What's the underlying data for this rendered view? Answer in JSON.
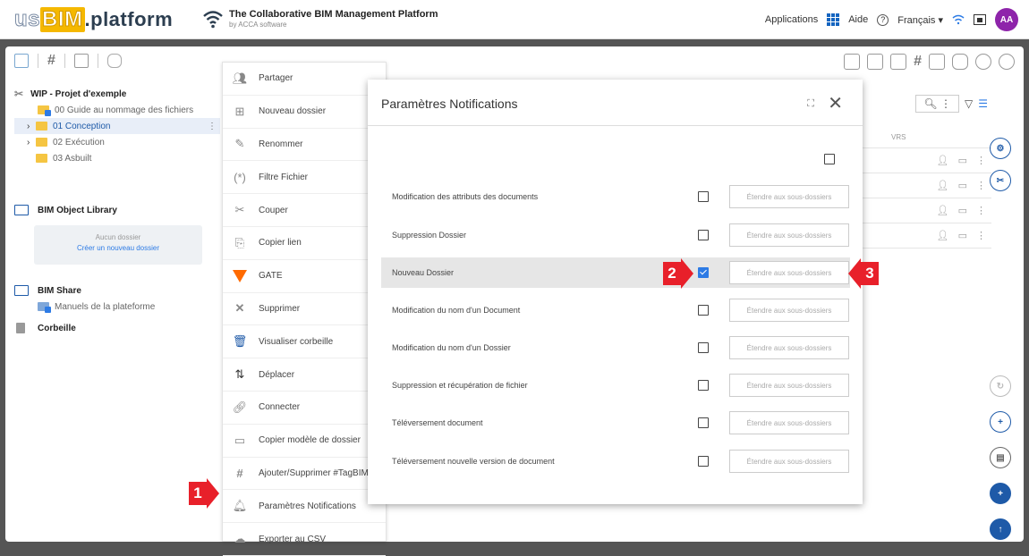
{
  "topbar": {
    "logo_us": "us",
    "logo_bim": "BIM",
    "logo_platform": ".platform",
    "tagline": "The Collaborative BIM Management Platform",
    "tagline_sub": "by ACCA software",
    "applications": "Applications",
    "help": "Aide",
    "language": "Français",
    "avatar": "AA"
  },
  "sidebar": {
    "project": "WIP - Projet d'exemple",
    "items": [
      {
        "label": "00 Guide au nommage des fichiers"
      },
      {
        "label": "01 Conception"
      },
      {
        "label": "02 Exécution"
      },
      {
        "label": "03 Asbuilt"
      }
    ],
    "library_title": "BIM Object Library",
    "library_empty": "Aucun dossier",
    "library_create": "Créer un nouveau dossier",
    "share_title": "BIM Share",
    "share_item": "Manuels de la plateforme",
    "trash": "Corbeille"
  },
  "context_menu": {
    "items": [
      {
        "label": "Partager"
      },
      {
        "label": "Nouveau dossier"
      },
      {
        "label": "Renommer"
      },
      {
        "label": "Filtre Fichier"
      },
      {
        "label": "Couper"
      },
      {
        "label": "Copier lien"
      },
      {
        "label": "GATE"
      },
      {
        "label": "Supprimer"
      },
      {
        "label": "Visualiser corbeille"
      },
      {
        "label": "Déplacer"
      },
      {
        "label": "Connecter"
      },
      {
        "label": "Copier modèle de dossier"
      },
      {
        "label": "Ajouter/Supprimer #TagBIM"
      },
      {
        "label": "Paramètres Notifications"
      },
      {
        "label": "Exporter au CSV"
      }
    ]
  },
  "filelist": {
    "col_header": "VRS"
  },
  "dialog": {
    "title": "Paramètres Notifications",
    "extend_label": "Étendre aux sous-dossiers",
    "rows": [
      {
        "label": "Modification des attributs des documents",
        "checked": false
      },
      {
        "label": "Suppression Dossier",
        "checked": false
      },
      {
        "label": "Nouveau Dossier",
        "checked": true
      },
      {
        "label": "Modification du nom d'un Document",
        "checked": false
      },
      {
        "label": "Modification du nom d'un Dossier",
        "checked": false
      },
      {
        "label": "Suppression et récupération de fichier",
        "checked": false
      },
      {
        "label": "Téléversement document",
        "checked": false
      },
      {
        "label": "Téléversement nouvelle version de document",
        "checked": false
      }
    ]
  },
  "annotations": {
    "step1": "1",
    "step2": "2",
    "step3": "3"
  },
  "colors": {
    "accent": "#2d7be5",
    "annotation": "#e8202a",
    "gate": "#ff6a00",
    "delete": "#e53935"
  }
}
